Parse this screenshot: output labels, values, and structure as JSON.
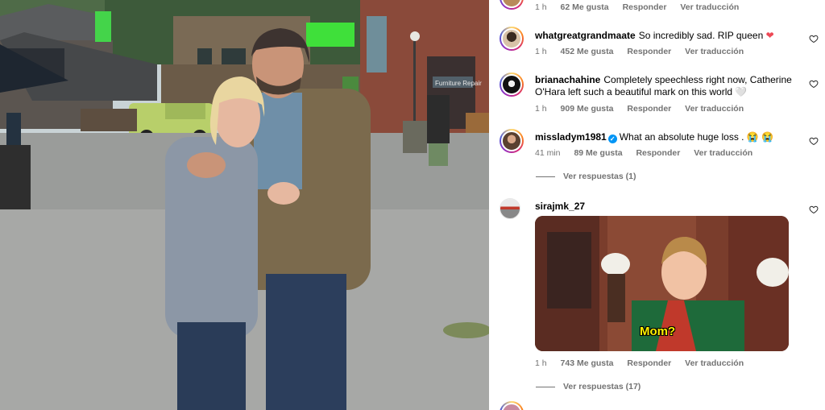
{
  "photo": {
    "store_sign": "Furniture Repair"
  },
  "comments": [
    {
      "likes": "62 Me gusta",
      "time": "1 h",
      "reply": "Responder",
      "translate": "Ver traducción"
    },
    {
      "username": "whatgreatgrandmaate",
      "text": "So incredibly sad. RIP queen",
      "emoji": "❤",
      "time": "1 h",
      "likes": "452 Me gusta",
      "reply": "Responder",
      "translate": "Ver traducción"
    },
    {
      "username": "brianachahine",
      "text": "Completely speechless right now, Catherine O'Hara left such a beautiful mark on this world",
      "emoji": "🤍",
      "time": "1 h",
      "likes": "909 Me gusta",
      "reply": "Responder",
      "translate": "Ver traducción"
    },
    {
      "username": "missladym1981",
      "text": "What an absolute huge loss .",
      "emoji": "😭 😭",
      "time": "41 min",
      "likes": "89 Me gusta",
      "reply": "Responder",
      "translate": "Ver traducción",
      "view_replies": "Ver respuestas (1)"
    },
    {
      "username": "sirajmk_27",
      "gif_caption": "Mom?",
      "time": "1 h",
      "likes": "743 Me gusta",
      "reply": "Responder",
      "translate": "Ver traducción",
      "view_replies": "Ver respuestas (17)"
    }
  ],
  "colors": {
    "meta_gray": "#737373",
    "link_blue": "#0095f6",
    "heart_red": "#ed4956"
  },
  "icons": {
    "like": "heart-outline-icon",
    "verified": "verified-badge-icon"
  }
}
